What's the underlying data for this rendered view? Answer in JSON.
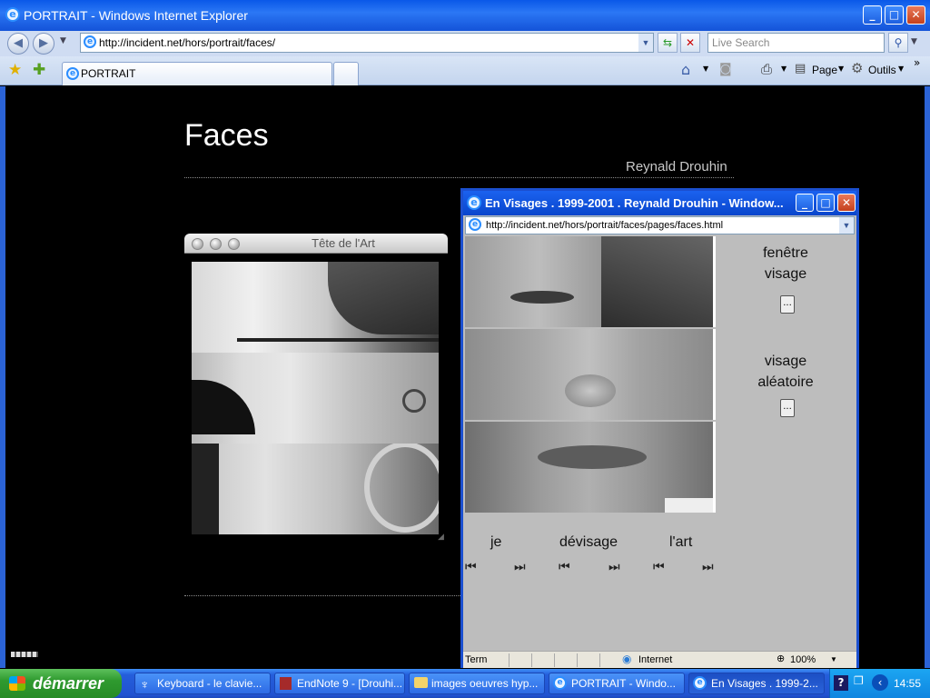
{
  "window": {
    "title": "PORTRAIT - Windows Internet Explorer"
  },
  "nav": {
    "url": "http://incident.net/hors/portrait/faces/",
    "search_placeholder": "Live Search"
  },
  "tabs": [
    {
      "label": "PORTRAIT"
    }
  ],
  "toolbar": {
    "page_label": "Page",
    "tools_label": "Outils"
  },
  "page": {
    "title": "Faces",
    "author": "Reynald Drouhin"
  },
  "mac_window": {
    "title": "Tête de l'Art"
  },
  "popup": {
    "title": "En Visages . 1999-2001 . Reynald Drouhin - Window...",
    "url": "http://incident.net/hors/portrait/faces/pages/faces.html",
    "side": {
      "window_face_l1": "fenêtre",
      "window_face_l2": "visage",
      "random_face_l1": "visage",
      "random_face_l2": "aléatoire",
      "button_label": "..."
    },
    "nav_labels": [
      "je",
      "dévisage",
      "l'art"
    ],
    "status": {
      "left": "Term",
      "zone": "Internet",
      "zoom": "100%"
    }
  },
  "taskbar": {
    "start_label": "démarrer",
    "tasks": [
      "Keyboard - le clavie...",
      "EndNote 9 - [Drouhi...",
      "images oeuvres hyp...",
      "PORTRAIT - Windo...",
      "En Visages . 1999-2..."
    ],
    "clock": "14:55"
  },
  "colors": {
    "ie_blue": "#1b62ef",
    "start_green": "#2f9a2f",
    "page_bg": "#000000"
  }
}
